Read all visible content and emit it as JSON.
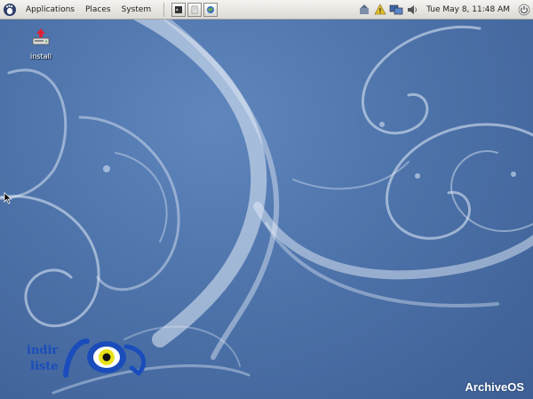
{
  "panel": {
    "menus": [
      "Applications",
      "Places",
      "System"
    ],
    "clock": "Tue May  8, 11:48 AM"
  },
  "desktop": {
    "icons": [
      {
        "label": "install",
        "icon": "install-drive-icon"
      }
    ]
  },
  "watermark": {
    "logo_text_top": "indir",
    "logo_text_bottom": "liste",
    "brand": "ArchiveOS"
  },
  "colors": {
    "wallpaper_base": "#4d73aa",
    "panel": "#e6e4df",
    "swirl": "#dfe8f5"
  }
}
